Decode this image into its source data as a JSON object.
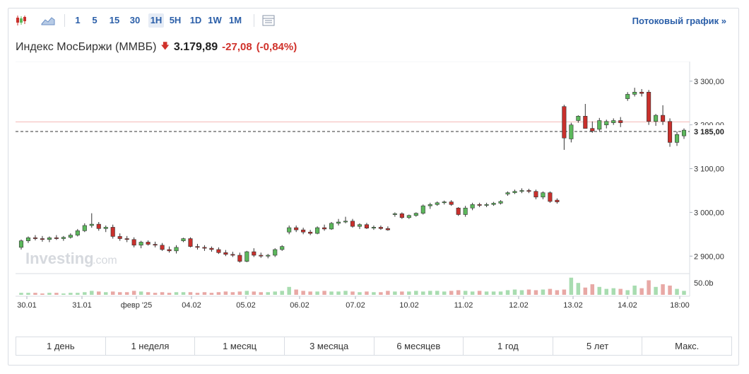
{
  "toolbar": {
    "intervals": [
      "1",
      "5",
      "15",
      "30",
      "1H",
      "5H",
      "1D",
      "1W",
      "1M"
    ],
    "active_interval": "1H",
    "stream_label": "Потоковый график »"
  },
  "header": {
    "name": "Индекс МосБиржи (MMBБ)",
    "price": "3.179,89",
    "change": "-27,08",
    "change_pct": "(-0,84%)"
  },
  "colors": {
    "up": "#5cb85c",
    "down": "#c9302c",
    "accent": "#2a5ea8"
  },
  "chart_data": {
    "type": "candlestick",
    "y_ticks": [
      "3 300,00",
      "3 200,00",
      "3 100,00",
      "3 000,00",
      "2 900,00"
    ],
    "y_tick_values": [
      3300,
      3200,
      3100,
      3000,
      2900
    ],
    "ylim": [
      2860,
      3345
    ],
    "volume_label": "50.0b",
    "x_labels": [
      "30.01",
      "31.01",
      "февр '25",
      "04.02",
      "05.02",
      "06.02",
      "07.02",
      "10.02",
      "11.02",
      "12.02",
      "13.02",
      "14.02",
      "18:00"
    ],
    "last_value_label": "3 185,00",
    "last_value": 3185,
    "prev_close_value": 3207,
    "watermark": "Investing.com",
    "candles": [
      {
        "o": 2920,
        "h": 2938,
        "l": 2915,
        "c": 2935
      },
      {
        "o": 2935,
        "h": 2945,
        "l": 2930,
        "c": 2942
      },
      {
        "o": 2942,
        "h": 2948,
        "l": 2936,
        "c": 2940
      },
      {
        "o": 2940,
        "h": 2946,
        "l": 2933,
        "c": 2938
      },
      {
        "o": 2938,
        "h": 2945,
        "l": 2932,
        "c": 2942
      },
      {
        "o": 2942,
        "h": 2948,
        "l": 2937,
        "c": 2940
      },
      {
        "o": 2940,
        "h": 2946,
        "l": 2935,
        "c": 2943
      },
      {
        "o": 2943,
        "h": 2952,
        "l": 2940,
        "c": 2948
      },
      {
        "o": 2948,
        "h": 2962,
        "l": 2945,
        "c": 2958
      },
      {
        "o": 2958,
        "h": 2975,
        "l": 2955,
        "c": 2970
      },
      {
        "o": 2970,
        "h": 2998,
        "l": 2965,
        "c": 2973
      },
      {
        "o": 2973,
        "h": 2978,
        "l": 2958,
        "c": 2963
      },
      {
        "o": 2963,
        "h": 2970,
        "l": 2955,
        "c": 2966
      },
      {
        "o": 2966,
        "h": 2972,
        "l": 2940,
        "c": 2945
      },
      {
        "o": 2945,
        "h": 2952,
        "l": 2935,
        "c": 2940
      },
      {
        "o": 2940,
        "h": 2946,
        "l": 2932,
        "c": 2938
      },
      {
        "o": 2938,
        "h": 2943,
        "l": 2920,
        "c": 2925
      },
      {
        "o": 2925,
        "h": 2935,
        "l": 2918,
        "c": 2932
      },
      {
        "o": 2932,
        "h": 2936,
        "l": 2924,
        "c": 2927
      },
      {
        "o": 2927,
        "h": 2933,
        "l": 2920,
        "c": 2925
      },
      {
        "o": 2925,
        "h": 2930,
        "l": 2912,
        "c": 2915
      },
      {
        "o": 2915,
        "h": 2922,
        "l": 2908,
        "c": 2912
      },
      {
        "o": 2912,
        "h": 2925,
        "l": 2906,
        "c": 2920
      },
      {
        "o": 2935,
        "h": 2942,
        "l": 2932,
        "c": 2940
      },
      {
        "o": 2940,
        "h": 2943,
        "l": 2920,
        "c": 2922
      },
      {
        "o": 2922,
        "h": 2928,
        "l": 2915,
        "c": 2920
      },
      {
        "o": 2920,
        "h": 2925,
        "l": 2912,
        "c": 2918
      },
      {
        "o": 2918,
        "h": 2922,
        "l": 2910,
        "c": 2915
      },
      {
        "o": 2915,
        "h": 2920,
        "l": 2905,
        "c": 2908
      },
      {
        "o": 2908,
        "h": 2914,
        "l": 2900,
        "c": 2904
      },
      {
        "o": 2904,
        "h": 2910,
        "l": 2898,
        "c": 2902
      },
      {
        "o": 2902,
        "h": 2908,
        "l": 2885,
        "c": 2888
      },
      {
        "o": 2888,
        "h": 2912,
        "l": 2886,
        "c": 2910
      },
      {
        "o": 2910,
        "h": 2918,
        "l": 2898,
        "c": 2902
      },
      {
        "o": 2902,
        "h": 2908,
        "l": 2896,
        "c": 2900
      },
      {
        "o": 2900,
        "h": 2905,
        "l": 2895,
        "c": 2902
      },
      {
        "o": 2902,
        "h": 2918,
        "l": 2898,
        "c": 2915
      },
      {
        "o": 2915,
        "h": 2925,
        "l": 2912,
        "c": 2922
      },
      {
        "o": 2955,
        "h": 2970,
        "l": 2950,
        "c": 2965
      },
      {
        "o": 2965,
        "h": 2970,
        "l": 2955,
        "c": 2960
      },
      {
        "o": 2960,
        "h": 2965,
        "l": 2950,
        "c": 2955
      },
      {
        "o": 2955,
        "h": 2960,
        "l": 2948,
        "c": 2952
      },
      {
        "o": 2952,
        "h": 2968,
        "l": 2950,
        "c": 2965
      },
      {
        "o": 2965,
        "h": 2972,
        "l": 2958,
        "c": 2962
      },
      {
        "o": 2962,
        "h": 2978,
        "l": 2960,
        "c": 2975
      },
      {
        "o": 2975,
        "h": 2985,
        "l": 2970,
        "c": 2978
      },
      {
        "o": 2978,
        "h": 2990,
        "l": 2975,
        "c": 2980
      },
      {
        "o": 2980,
        "h": 2985,
        "l": 2965,
        "c": 2968
      },
      {
        "o": 2968,
        "h": 2975,
        "l": 2962,
        "c": 2972
      },
      {
        "o": 2972,
        "h": 2976,
        "l": 2962,
        "c": 2964
      },
      {
        "o": 2964,
        "h": 2970,
        "l": 2960,
        "c": 2966
      },
      {
        "o": 2966,
        "h": 2970,
        "l": 2960,
        "c": 2963
      },
      {
        "o": 2963,
        "h": 2968,
        "l": 2958,
        "c": 2960
      },
      {
        "o": 2995,
        "h": 3000,
        "l": 2990,
        "c": 2997
      },
      {
        "o": 2997,
        "h": 3000,
        "l": 2985,
        "c": 2988
      },
      {
        "o": 2988,
        "h": 2995,
        "l": 2985,
        "c": 2993
      },
      {
        "o": 2993,
        "h": 3000,
        "l": 2990,
        "c": 2998
      },
      {
        "o": 2998,
        "h": 3018,
        "l": 2995,
        "c": 3015
      },
      {
        "o": 3015,
        "h": 3022,
        "l": 3008,
        "c": 3018
      },
      {
        "o": 3018,
        "h": 3025,
        "l": 3015,
        "c": 3022
      },
      {
        "o": 3022,
        "h": 3027,
        "l": 3018,
        "c": 3024
      },
      {
        "o": 3024,
        "h": 3028,
        "l": 3015,
        "c": 3018
      },
      {
        "o": 3010,
        "h": 3012,
        "l": 2992,
        "c": 2995
      },
      {
        "o": 2995,
        "h": 3015,
        "l": 2990,
        "c": 3010
      },
      {
        "o": 3010,
        "h": 3022,
        "l": 3005,
        "c": 3018
      },
      {
        "o": 3018,
        "h": 3022,
        "l": 3012,
        "c": 3016
      },
      {
        "o": 3016,
        "h": 3022,
        "l": 3012,
        "c": 3018
      },
      {
        "o": 3018,
        "h": 3024,
        "l": 3015,
        "c": 3021
      },
      {
        "o": 3021,
        "h": 3028,
        "l": 3018,
        "c": 3025
      },
      {
        "o": 3042,
        "h": 3048,
        "l": 3038,
        "c": 3045
      },
      {
        "o": 3045,
        "h": 3052,
        "l": 3042,
        "c": 3048
      },
      {
        "o": 3048,
        "h": 3055,
        "l": 3044,
        "c": 3050
      },
      {
        "o": 3050,
        "h": 3054,
        "l": 3044,
        "c": 3048
      },
      {
        "o": 3048,
        "h": 3052,
        "l": 3030,
        "c": 3035
      },
      {
        "o": 3035,
        "h": 3048,
        "l": 3030,
        "c": 3045
      },
      {
        "o": 3045,
        "h": 3048,
        "l": 3022,
        "c": 3025
      },
      {
        "o": 3028,
        "h": 3032,
        "l": 3020,
        "c": 3024
      },
      {
        "o": 3242,
        "h": 3246,
        "l": 3143,
        "c": 3170
      },
      {
        "o": 3168,
        "h": 3205,
        "l": 3160,
        "c": 3200
      },
      {
        "o": 3210,
        "h": 3222,
        "l": 3205,
        "c": 3220
      },
      {
        "o": 3220,
        "h": 3248,
        "l": 3212,
        "c": 3192
      },
      {
        "o": 3192,
        "h": 3208,
        "l": 3182,
        "c": 3186
      },
      {
        "o": 3190,
        "h": 3216,
        "l": 3186,
        "c": 3210
      },
      {
        "o": 3200,
        "h": 3212,
        "l": 3192,
        "c": 3208
      },
      {
        "o": 3205,
        "h": 3215,
        "l": 3200,
        "c": 3210
      },
      {
        "o": 3210,
        "h": 3218,
        "l": 3195,
        "c": 3205
      },
      {
        "o": 3260,
        "h": 3275,
        "l": 3255,
        "c": 3270
      },
      {
        "o": 3270,
        "h": 3285,
        "l": 3265,
        "c": 3275
      },
      {
        "o": 3275,
        "h": 3282,
        "l": 3265,
        "c": 3272
      },
      {
        "o": 3275,
        "h": 3280,
        "l": 3200,
        "c": 3208
      },
      {
        "o": 3208,
        "h": 3225,
        "l": 3198,
        "c": 3222
      },
      {
        "o": 3222,
        "h": 3245,
        "l": 3200,
        "c": 3208
      },
      {
        "o": 3208,
        "h": 3215,
        "l": 3150,
        "c": 3160
      },
      {
        "o": 3160,
        "h": 3185,
        "l": 3152,
        "c": 3178
      },
      {
        "o": 3175,
        "h": 3192,
        "l": 3168,
        "c": 3188
      }
    ],
    "volumes": [
      3,
      3,
      3,
      2,
      3,
      3,
      2,
      3,
      3,
      4,
      6,
      5,
      4,
      5,
      4,
      4,
      6,
      5,
      4,
      3,
      4,
      3,
      4,
      4,
      4,
      3,
      4,
      3,
      4,
      5,
      4,
      5,
      6,
      5,
      4,
      4,
      5,
      6,
      12,
      8,
      6,
      5,
      5,
      6,
      5,
      5,
      6,
      5,
      4,
      5,
      4,
      4,
      6,
      5,
      5,
      5,
      6,
      5,
      6,
      6,
      5,
      6,
      7,
      6,
      5,
      6,
      5,
      5,
      5,
      7,
      8,
      7,
      8,
      7,
      8,
      9,
      7,
      8,
      26,
      18,
      11,
      16,
      12,
      9,
      10,
      9,
      7,
      14,
      10,
      22,
      12,
      16,
      14,
      9,
      6
    ]
  },
  "ranges": [
    "1 день",
    "1 неделя",
    "1 месяц",
    "3 месяца",
    "6 месяцев",
    "1 год",
    "5 лет",
    "Макс."
  ]
}
